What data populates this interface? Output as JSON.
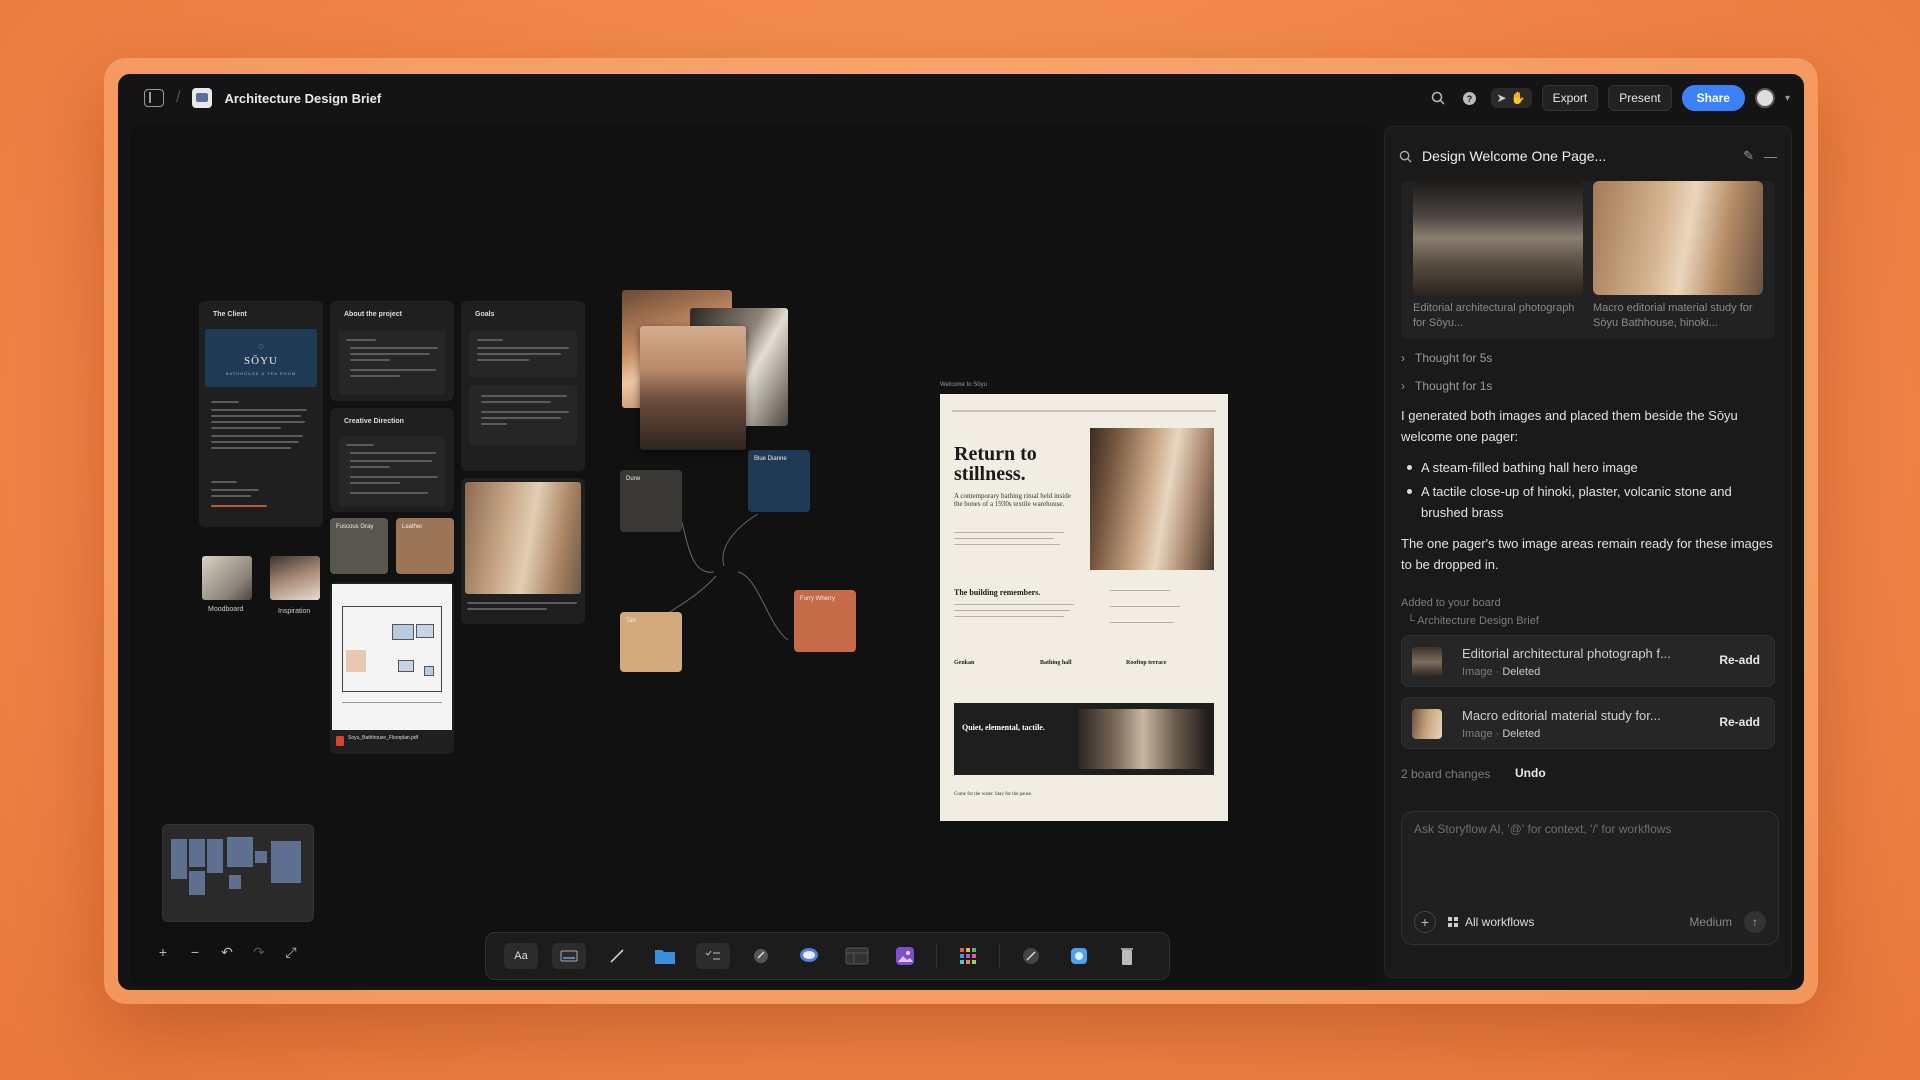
{
  "window": {
    "doc_title": "Architecture Design Brief"
  },
  "topbar": {
    "export_label": "Export",
    "present_label": "Present",
    "share_label": "Share",
    "icons": [
      "sidebar-toggle-icon",
      "search-icon",
      "help-icon",
      "cursor-icon",
      "hand-icon",
      "avatar"
    ]
  },
  "canvas": {
    "client_card": {
      "title": "The Client",
      "logo_text": "SŌYU",
      "logo_sub": "BATHHOUSE & TEA ROOM"
    },
    "about_card": {
      "title": "About the project"
    },
    "goals_card": {
      "title": "Goals"
    },
    "creative_card": {
      "title": "Creative Direction"
    },
    "moodboard_label": "Moodboard",
    "inspiration_label": "Inspiration",
    "swatches": [
      {
        "label": "Fuscous Gray",
        "color": "#59564f"
      },
      {
        "label": "Leather",
        "color": "#9c7556"
      },
      {
        "label": "Dune",
        "color": "#3a3835"
      },
      {
        "label": "Blue Dianne",
        "color": "#1f3a55"
      },
      {
        "label": "Tan",
        "color": "#d3aa7c"
      },
      {
        "label": "Furry Wherry",
        "color": "#c66b48"
      }
    ],
    "floorplan_file": "Soyu_Bathhouse_Floorplan.pdf",
    "onepager": {
      "label": "Welcome to Sōyu",
      "title": "Return to stillness.",
      "subtitle": "A contemporary bathing ritual held inside the bones of a 1930s textile warehouse.",
      "section_heading": "The building remembers.",
      "col1": "Genkan",
      "col2": "Bathing hall",
      "col3": "Rooftop terrace",
      "dark_title": "Quiet, elemental, tactile.",
      "footer": "Come for the water. Stay for the pause."
    }
  },
  "toolbar": {
    "text_tool": "Aa",
    "tools": [
      "text-tool",
      "card-tool",
      "pen-tool",
      "folder-tool",
      "checklist-tool",
      "link-tool",
      "comment-tool",
      "table-tool",
      "image-gen-tool",
      "apps-tool",
      "sketch-tool",
      "storyflow-ai-tool",
      "trash-tool"
    ]
  },
  "panel": {
    "title": "Design Welcome One Page...",
    "images": [
      {
        "caption": "Editorial architectural photograph for Sōyu..."
      },
      {
        "caption": "Macro editorial material study for Sōyu Bathhouse, hinoki..."
      }
    ],
    "thoughts": [
      "Thought for 5s",
      "Thought for 1s"
    ],
    "message": "I generated both images and placed them beside the Sōyu welcome one pager:",
    "bullets": [
      "A steam-filled bathing hall hero image",
      "A tactile close-up of hinoki, plaster, volcanic stone and brushed brass"
    ],
    "message2": "The one pager's two image areas remain ready for these images to be dropped in.",
    "added_label": "Added to your board",
    "added_board": "Architecture Design Brief",
    "changes": [
      {
        "name": "Editorial architectural photograph f...",
        "type": "Image",
        "status": "Deleted",
        "action": "Re-add"
      },
      {
        "name": "Macro editorial material study for...",
        "type": "Image",
        "status": "Deleted",
        "action": "Re-add"
      }
    ],
    "board_changes": "2 board changes",
    "undo_label": "Undo",
    "composer_placeholder": "Ask Storyflow AI, '@' for context, '/' for workflows",
    "workflows_label": "All workflows",
    "model_label": "Medium"
  }
}
